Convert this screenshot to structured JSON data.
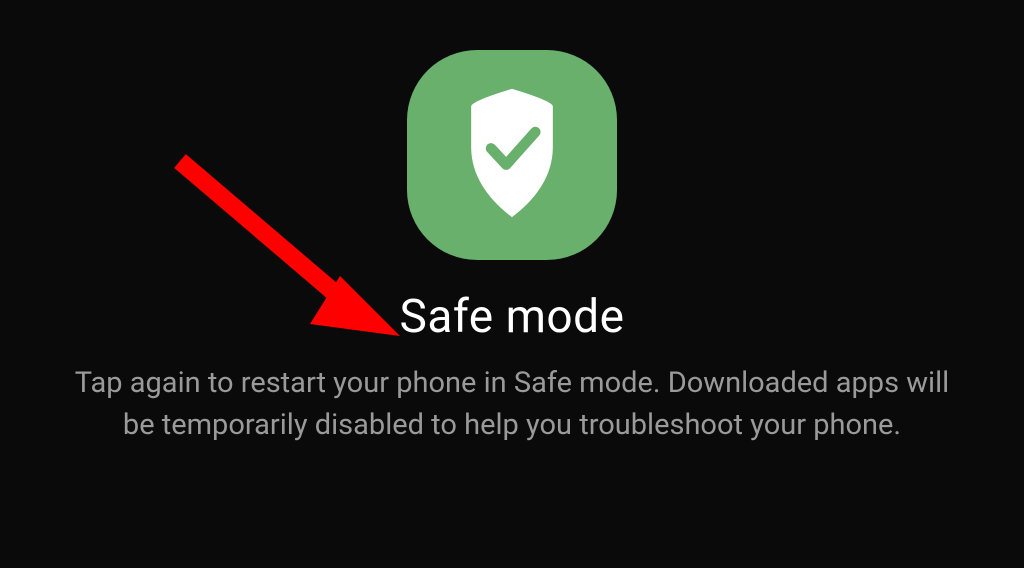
{
  "safemode": {
    "title": "Safe mode",
    "description": "Tap again to restart your phone in Safe mode. Downloaded apps will be temporarily disabled to help you troubleshoot your phone."
  }
}
